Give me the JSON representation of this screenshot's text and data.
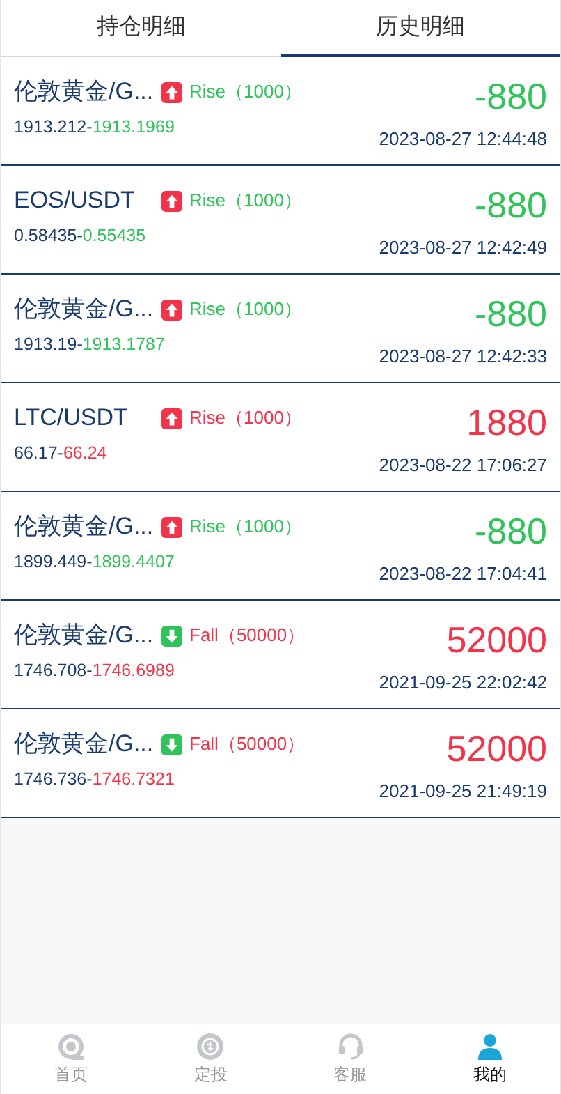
{
  "tabs": [
    {
      "label": "持仓明细",
      "selected": false
    },
    {
      "label": "历史明细",
      "selected": true
    }
  ],
  "orders": [
    {
      "name": "伦敦黄金/G...",
      "rising": true,
      "direction_label": "Rise",
      "amount": "（1000）",
      "open_price": "1913.212",
      "separator": "-",
      "close_price": "1913.1969",
      "profit": false,
      "result": "-880",
      "time": "2023-08-27 12:44:48"
    },
    {
      "name": "EOS/USDT",
      "rising": true,
      "direction_label": "Rise",
      "amount": "（1000）",
      "open_price": "0.58435",
      "separator": "-",
      "close_price": "0.55435",
      "profit": false,
      "result": "-880",
      "time": "2023-08-27 12:42:49"
    },
    {
      "name": "伦敦黄金/G...",
      "rising": true,
      "direction_label": "Rise",
      "amount": "（1000）",
      "open_price": "1913.19",
      "separator": "-",
      "close_price": "1913.1787",
      "profit": false,
      "result": "-880",
      "time": "2023-08-27 12:42:33"
    },
    {
      "name": "LTC/USDT",
      "rising": true,
      "direction_label": "Rise",
      "amount": "（1000）",
      "open_price": "66.17",
      "separator": "-",
      "close_price": "66.24",
      "profit": true,
      "result": "1880",
      "time": "2023-08-22 17:06:27"
    },
    {
      "name": "伦敦黄金/G...",
      "rising": true,
      "direction_label": "Rise",
      "amount": "（1000）",
      "open_price": "1899.449",
      "separator": "-",
      "close_price": "1899.4407",
      "profit": false,
      "result": "-880",
      "time": "2023-08-22 17:04:41"
    },
    {
      "name": "伦敦黄金/G...",
      "rising": false,
      "direction_label": "Fall",
      "amount": "（50000）",
      "open_price": "1746.708",
      "separator": "-",
      "close_price": "1746.6989",
      "profit": true,
      "result": "52000",
      "time": "2021-09-25 22:02:42"
    },
    {
      "name": "伦敦黄金/G...",
      "rising": false,
      "direction_label": "Fall",
      "amount": "（50000）",
      "open_price": "1746.736",
      "separator": "-",
      "close_price": "1746.7321",
      "profit": true,
      "result": "52000",
      "time": "2021-09-25 21:49:19"
    }
  ],
  "bottom_nav": [
    {
      "kind": "home",
      "label": "首页",
      "selected": false
    },
    {
      "kind": "invest",
      "label": "定投",
      "selected": false
    },
    {
      "kind": "service",
      "label": "客服",
      "selected": false
    },
    {
      "kind": "profile",
      "label": "我的",
      "selected": true
    }
  ]
}
